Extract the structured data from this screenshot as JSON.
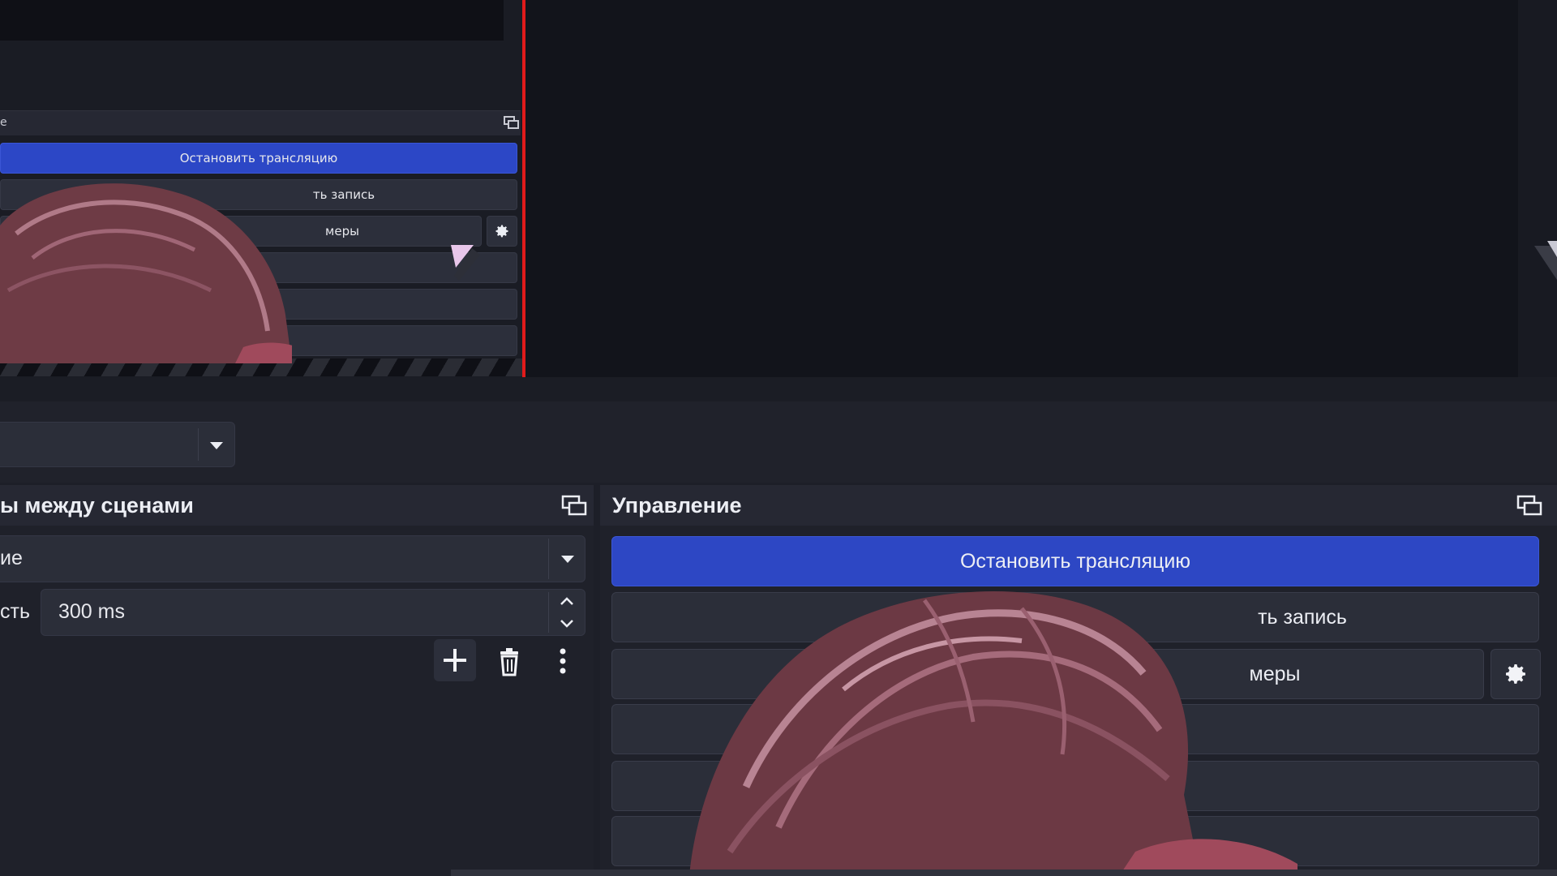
{
  "nested_controls": {
    "header_fragment": "e",
    "stop_stream_label": "Остановить трансляцию",
    "recording_fragment": "ть запись",
    "virtual_cam_fragment": "меры"
  },
  "transitions_dock": {
    "title_fragment": "ы между сценами",
    "transition_fragment": "ие",
    "duration_label_fragment": "сть",
    "duration_value": "300 ms"
  },
  "controls_dock": {
    "title": "Управление",
    "stop_stream_label": "Остановить трансляцию",
    "recording_fragment": "ть запись",
    "virtual_cam_fragment": "меры"
  },
  "icons": [
    "dock-float-icon",
    "chevron-down-icon",
    "chevron-up-icon",
    "plus-icon",
    "trash-icon",
    "more-vertical-icon",
    "gear-icon"
  ],
  "colors": {
    "accent": "#2d47c4",
    "live_border": "#e01b1b",
    "panel_bg": "#1f212a",
    "button_bg": "#2b2e39"
  }
}
